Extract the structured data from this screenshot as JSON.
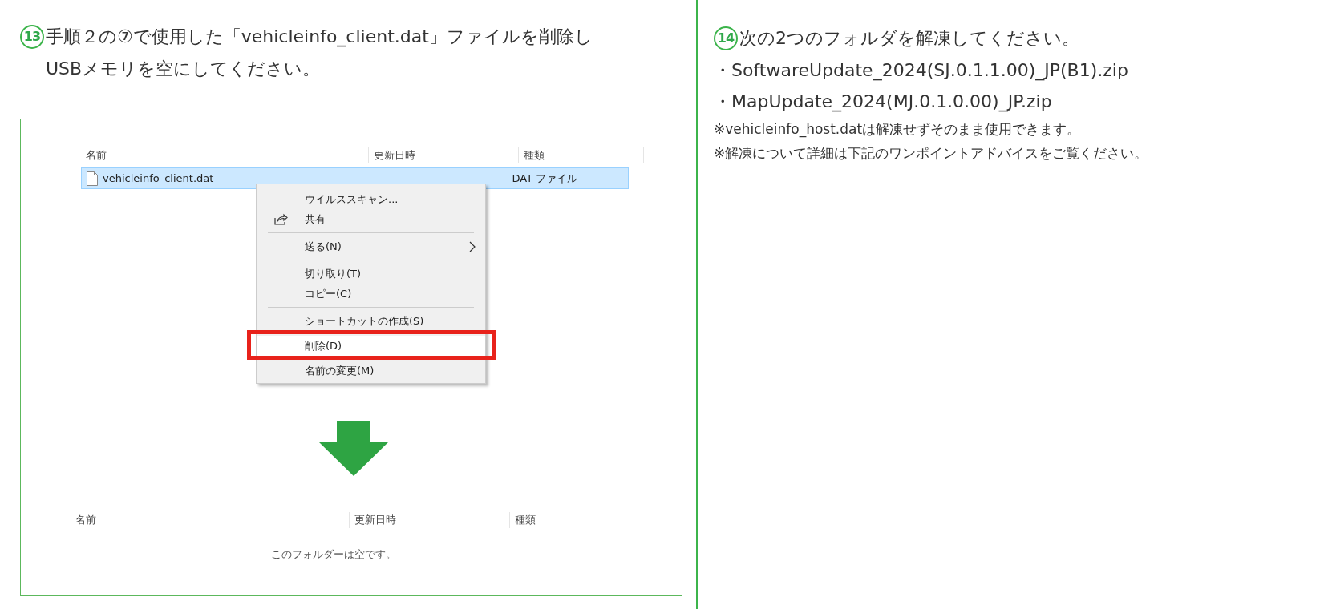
{
  "left": {
    "step": "13",
    "instruction": "手順２の⑦で使用した「vehicleinfo_client.dat」ファイルを削除しUSBメモリを空にしてください。",
    "before": {
      "columns": [
        "名前",
        "更新日時",
        "種類"
      ],
      "file": {
        "name": "vehicleinfo_client.dat",
        "type": "DAT ファイル",
        "selected": true
      },
      "context_menu": [
        [
          {
            "label": "ウイルススキャン...",
            "has_icon": false,
            "submenu": false,
            "highlighted": false
          },
          {
            "label": "共有",
            "has_icon": true,
            "submenu": false,
            "highlighted": false
          }
        ],
        [
          {
            "label": "送る(N)",
            "has_icon": false,
            "submenu": true,
            "highlighted": false
          }
        ],
        [
          {
            "label": "切り取り(T)",
            "has_icon": false,
            "submenu": false,
            "highlighted": false
          },
          {
            "label": "コピー(C)",
            "has_icon": false,
            "submenu": false,
            "highlighted": false
          }
        ],
        [
          {
            "label": "ショートカットの作成(S)",
            "has_icon": false,
            "submenu": false,
            "highlighted": false
          },
          {
            "label": "削除(D)",
            "has_icon": false,
            "submenu": false,
            "highlighted": true
          },
          {
            "label": "名前の変更(M)",
            "has_icon": false,
            "submenu": false,
            "highlighted": false
          }
        ]
      ]
    },
    "after": {
      "columns": [
        "名前",
        "更新日時",
        "種類"
      ],
      "empty_message": "このフォルダーは空です。"
    }
  },
  "right": {
    "step": "14",
    "instruction": "次の2つのフォルダを解凍してください。",
    "files": [
      "・SoftwareUpdate_2024(SJ.0.1.1.00)_JP(B1).zip",
      "・MapUpdate_2024(MJ.0.1.0.00)_JP.zip"
    ],
    "notes": [
      "※vehicleinfo_host.datは解凍せずそのまま使用できます。",
      "※解凍について詳細は下記のワンポイントアドバイスをご覧ください。"
    ]
  }
}
